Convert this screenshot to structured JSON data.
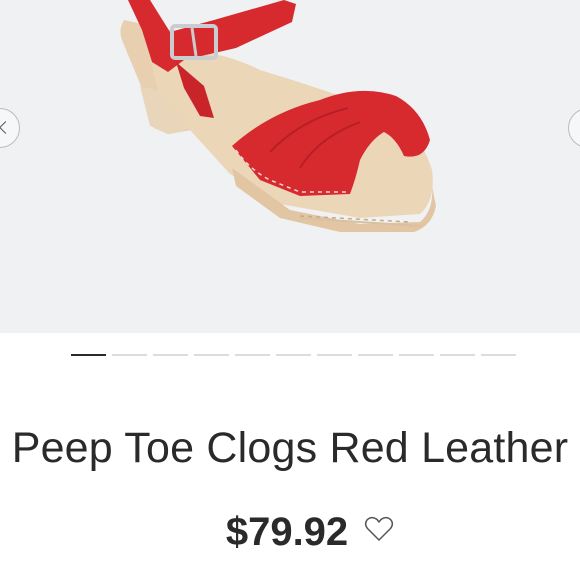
{
  "product": {
    "title": "Peep Toe Clogs Red Leather",
    "price": "$79.92"
  },
  "gallery": {
    "image_count": 11,
    "active_index": 0,
    "image_alt_icon": "red-peep-toe-clog",
    "background_color": "#f0f1f3"
  },
  "icons": {
    "prev": "chevron-left-icon",
    "next": "chevron-right-icon",
    "favorite": "heart-outline-icon"
  },
  "colors": {
    "shoe_leather": "#d62a2f",
    "wood_sole": "#ead2b4",
    "text": "#2a2a2a"
  }
}
